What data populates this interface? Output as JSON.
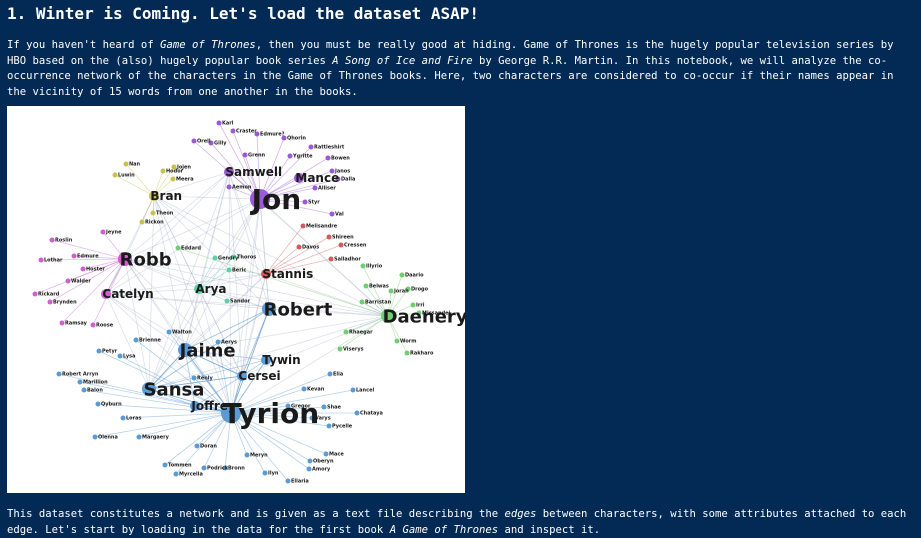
{
  "heading": "1. Winter is Coming. Let's load the dataset ASAP!",
  "intro": {
    "t1": "If you haven't heard of ",
    "em1": "Game of Thrones",
    "t2": ", then you must be really good at hiding. Game of Thrones is the hugely popular television series by HBO based on the (also) hugely popular book series ",
    "em2": "A Song of Ice and Fire",
    "t3": " by George R.R. Martin. In this notebook, we will analyze the co-occurrence network of the characters in the Game of Thrones books. Here, two characters are considered to co-occur if their names appear in the vicinity of 15 words from one another in the books."
  },
  "outro": {
    "t1": "This dataset constitutes a network and is given as a text file describing the ",
    "em1": "edges",
    "t2": " between characters, with some attributes attached to each edge. Let's start by loading in the data for the first book ",
    "em2": "A Game of Thrones",
    "t3": " and inspect it."
  },
  "network": {
    "colors": {
      "north": "#9b59d6",
      "wall": "#c65fcf",
      "bran": "#c9c24a",
      "stark": "#cf5fcf",
      "court": "#5b9bd5",
      "stannis": "#d45a5a",
      "green": "#6fcf6f",
      "teal": "#5fcfa8"
    },
    "nodes": [
      {
        "name": "Jon",
        "g": "north",
        "big": "xl"
      },
      {
        "name": "Samwell",
        "g": "north",
        "big": "m"
      },
      {
        "name": "Mance",
        "g": "north",
        "big": "m"
      },
      {
        "name": "Craster",
        "g": "north"
      },
      {
        "name": "Edmure?",
        "g": "north"
      },
      {
        "name": "Qhorin",
        "g": "north"
      },
      {
        "name": "Rattleshirt",
        "g": "north"
      },
      {
        "name": "Gilly",
        "g": "north"
      },
      {
        "name": "Grenn",
        "g": "north"
      },
      {
        "name": "Ygritte",
        "g": "north"
      },
      {
        "name": "Janos",
        "g": "north"
      },
      {
        "name": "Bowen",
        "g": "north"
      },
      {
        "name": "Aemon",
        "g": "north"
      },
      {
        "name": "Alliser",
        "g": "north"
      },
      {
        "name": "Styr",
        "g": "north"
      },
      {
        "name": "Dalla",
        "g": "north"
      },
      {
        "name": "Val",
        "g": "north"
      },
      {
        "name": "Orell",
        "g": "north"
      },
      {
        "name": "Karl",
        "g": "north"
      },
      {
        "name": "Bran",
        "g": "bran",
        "big": "m"
      },
      {
        "name": "Jojen",
        "g": "bran"
      },
      {
        "name": "Meera",
        "g": "bran"
      },
      {
        "name": "Hodor",
        "g": "bran"
      },
      {
        "name": "Nan",
        "g": "bran"
      },
      {
        "name": "Luwin",
        "g": "bran"
      },
      {
        "name": "Theon",
        "g": "bran"
      },
      {
        "name": "Rickon",
        "g": "bran"
      },
      {
        "name": "Robb",
        "g": "stark",
        "big": "l"
      },
      {
        "name": "Catelyn",
        "g": "stark",
        "big": "m"
      },
      {
        "name": "Edmure",
        "g": "stark"
      },
      {
        "name": "Walder",
        "g": "stark"
      },
      {
        "name": "Hoster",
        "g": "stark"
      },
      {
        "name": "Brynden",
        "g": "stark"
      },
      {
        "name": "Roslin",
        "g": "stark"
      },
      {
        "name": "Lothar",
        "g": "stark"
      },
      {
        "name": "Jeyne",
        "g": "stark"
      },
      {
        "name": "Rickard",
        "g": "stark"
      },
      {
        "name": "Ramsay",
        "g": "stark"
      },
      {
        "name": "Roose",
        "g": "stark"
      },
      {
        "name": "Stannis",
        "g": "stannis",
        "big": "m"
      },
      {
        "name": "Davos",
        "g": "stannis"
      },
      {
        "name": "Melisandre",
        "g": "stannis"
      },
      {
        "name": "Renly",
        "g": "court"
      },
      {
        "name": "Eddard",
        "g": "green"
      },
      {
        "name": "Arya",
        "g": "teal",
        "big": "m"
      },
      {
        "name": "Sandor",
        "g": "teal"
      },
      {
        "name": "Beric",
        "g": "teal"
      },
      {
        "name": "Gendry",
        "g": "teal"
      },
      {
        "name": "Thoros",
        "g": "teal"
      },
      {
        "name": "Robert",
        "g": "court",
        "big": "l"
      },
      {
        "name": "Daenerys",
        "g": "green",
        "big": "l"
      },
      {
        "name": "Jorah",
        "g": "green"
      },
      {
        "name": "Barristan",
        "g": "green"
      },
      {
        "name": "Belwas",
        "g": "green"
      },
      {
        "name": "Daario",
        "g": "green"
      },
      {
        "name": "Drogo",
        "g": "green"
      },
      {
        "name": "Irri",
        "g": "green"
      },
      {
        "name": "Missandei",
        "g": "green"
      },
      {
        "name": "Rhaegar",
        "g": "green"
      },
      {
        "name": "Viserys",
        "g": "green"
      },
      {
        "name": "Worm",
        "g": "green"
      },
      {
        "name": "Rakharo",
        "g": "green"
      },
      {
        "name": "Illyrio",
        "g": "green"
      },
      {
        "name": "Jaime",
        "g": "court",
        "big": "l"
      },
      {
        "name": "Brienne",
        "g": "court"
      },
      {
        "name": "Petyr",
        "g": "court"
      },
      {
        "name": "Lysa",
        "g": "court"
      },
      {
        "name": "Walton",
        "g": "court"
      },
      {
        "name": "Cersei",
        "g": "court",
        "big": "m"
      },
      {
        "name": "Tywin",
        "g": "court",
        "big": "m"
      },
      {
        "name": "Sansa",
        "g": "court",
        "big": "l"
      },
      {
        "name": "Joffrey",
        "g": "court",
        "big": "m"
      },
      {
        "name": "Tyrion",
        "g": "court",
        "big": "xl"
      },
      {
        "name": "Loras",
        "g": "court"
      },
      {
        "name": "Margaery",
        "g": "court"
      },
      {
        "name": "Gregor",
        "g": "court"
      },
      {
        "name": "Varys",
        "g": "court"
      },
      {
        "name": "Kevan",
        "g": "court"
      },
      {
        "name": "Shae",
        "g": "court"
      },
      {
        "name": "Pycelle",
        "g": "court"
      },
      {
        "name": "Oberyn",
        "g": "court"
      },
      {
        "name": "Elia",
        "g": "court"
      },
      {
        "name": "Tommen",
        "g": "court"
      },
      {
        "name": "Myrcella",
        "g": "court"
      },
      {
        "name": "Podrick",
        "g": "court"
      },
      {
        "name": "Bronn",
        "g": "court"
      },
      {
        "name": "Meryn",
        "g": "court"
      },
      {
        "name": "Ilyn",
        "g": "court"
      },
      {
        "name": "Mace",
        "g": "court"
      },
      {
        "name": "Olenna",
        "g": "court"
      },
      {
        "name": "Qyburn",
        "g": "court"
      },
      {
        "name": "Balon",
        "g": "court"
      },
      {
        "name": "Robert Arryn",
        "g": "court"
      },
      {
        "name": "Marillion",
        "g": "court"
      },
      {
        "name": "Ellaria",
        "g": "court"
      },
      {
        "name": "Amory",
        "g": "court"
      },
      {
        "name": "Lancel",
        "g": "court"
      },
      {
        "name": "Chataya",
        "g": "court"
      },
      {
        "name": "Aerys",
        "g": "court"
      },
      {
        "name": "Doran",
        "g": "court"
      },
      {
        "name": "Salladhor",
        "g": "stannis"
      },
      {
        "name": "Shireen",
        "g": "stannis"
      },
      {
        "name": "Cressen",
        "g": "stannis"
      }
    ]
  }
}
